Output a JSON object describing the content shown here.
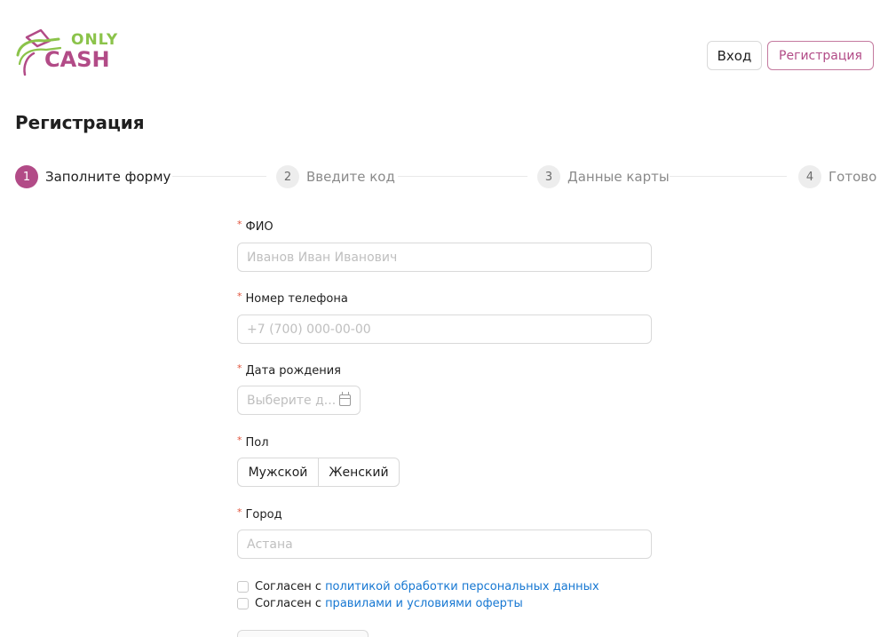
{
  "brand": {
    "logo_line1": "ONLY",
    "logo_line2": "CASH",
    "colors": {
      "primary": "#b24b87",
      "secondary": "#8bc34a",
      "link": "#1677d2",
      "required": "#e0533b"
    }
  },
  "header": {
    "login_label": "Вход",
    "register_label": "Регистрация"
  },
  "page": {
    "title": "Регистрация"
  },
  "steps": [
    {
      "number": "1",
      "label": "Заполните форму",
      "state": "active"
    },
    {
      "number": "2",
      "label": "Введите код",
      "state": "inactive"
    },
    {
      "number": "3",
      "label": "Данные карты",
      "state": "inactive"
    },
    {
      "number": "4",
      "label": "Готово",
      "state": "inactive"
    }
  ],
  "form": {
    "required_mark": "*",
    "full_name": {
      "label": "ФИО",
      "placeholder": "Иванов Иван Иванович",
      "value": ""
    },
    "phone": {
      "label": "Номер телефона",
      "placeholder": "+7 (700) 000-00-00",
      "value": ""
    },
    "birth_date": {
      "label": "Дата рождения",
      "placeholder": "Выберите д...",
      "icon": "calendar-icon",
      "value": ""
    },
    "gender": {
      "label": "Пол",
      "options": [
        "Мужской",
        "Женский"
      ]
    },
    "city": {
      "label": "Город",
      "placeholder": "Астана",
      "value": ""
    },
    "consents": [
      {
        "prefix": "Согласен с",
        "link_text": "политикой обработки персональных данных",
        "checked": false
      },
      {
        "prefix": "Согласен с",
        "link_text": "правилами и условиями оферты",
        "checked": false
      }
    ]
  }
}
